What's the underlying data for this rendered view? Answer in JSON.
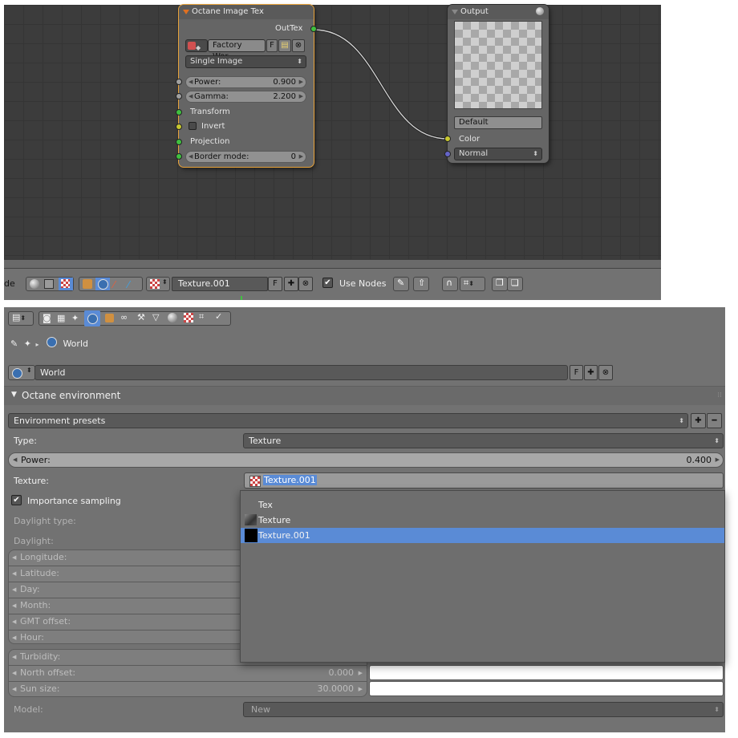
{
  "node_editor": {
    "image_node": {
      "title": "Octane Image Tex",
      "output_label": "OutTex",
      "image_name": "Factory Wor...",
      "f_label": "F",
      "mode": "Single Image",
      "power_label": "Power:",
      "power_value": "0.900",
      "gamma_label": "Gamma:",
      "gamma_value": "2.200",
      "transform_label": "Transform",
      "invert_label": "Invert",
      "projection_label": "Projection",
      "border_label": "Border mode:",
      "border_value": "0"
    },
    "output_node": {
      "title": "Output",
      "default_label": "Default",
      "color_label": "Color",
      "normal_label": "Normal"
    },
    "header": {
      "mode_fragment": "de",
      "texture_name": "Texture.001",
      "f_label": "F",
      "use_nodes_label": "Use Nodes"
    }
  },
  "properties": {
    "breadcrumb_world": "World",
    "world_name": "World",
    "f_label": "F",
    "panel_title": "Octane environment",
    "presets_label": "Environment presets",
    "type_label": "Type:",
    "type_value": "Texture",
    "power_label": "Power:",
    "power_value": "0.400",
    "texture_label": "Texture:",
    "texture_value": "Texture.001",
    "importance_label": "Importance sampling",
    "daylight_type_label": "Daylight type:",
    "daylight_label": "Daylight:",
    "daylight_fields": [
      "Longitude:",
      "Latitude:",
      "Day:",
      "Month:",
      "GMT offset:",
      "Hour:"
    ],
    "turbidity_label": "Turbidity:",
    "north_offset_label": "North offset:",
    "north_offset_value": "0.000",
    "sun_size_label": "Sun size:",
    "sun_size_value": "30.0000",
    "model_label": "Model:",
    "model_value": "New"
  },
  "dropdown": {
    "items": [
      "Tex",
      "Texture",
      "Texture.001"
    ],
    "selected": "Texture.001"
  },
  "colors": {
    "selection_blue": "#5a8bd6",
    "node_selected_outline": "#e8a33a",
    "socket_green": "#40c040",
    "socket_yellow": "#c8c830",
    "socket_grey": "#a0a0a0",
    "socket_blue": "#6464c8"
  }
}
